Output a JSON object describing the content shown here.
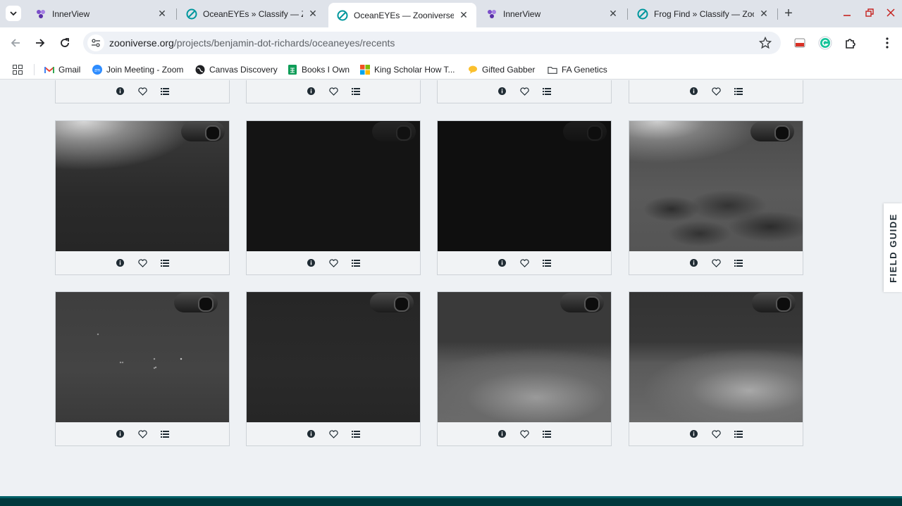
{
  "tabs": [
    {
      "title": "InnerView",
      "icon": "innerview-icon",
      "active": false
    },
    {
      "title": "OceanEYEs » Classify — Zo",
      "icon": "zooniverse-icon",
      "active": false
    },
    {
      "title": "OceanEYEs — Zooniverse",
      "icon": "zooniverse-icon",
      "active": true
    },
    {
      "title": "InnerView",
      "icon": "innerview-icon",
      "active": false
    },
    {
      "title": "Frog Find » Classify — Zoon",
      "icon": "zooniverse-icon",
      "active": false
    }
  ],
  "address": {
    "host": "zooniverse.org",
    "path": "/projects/benjamin-dot-richards/oceaneyes/recents"
  },
  "bookmarks": [
    {
      "label": "Gmail",
      "icon": "gmail-icon"
    },
    {
      "label": "Join Meeting - Zoom",
      "icon": "zoom-icon"
    },
    {
      "label": "Canvas Discovery",
      "icon": "globe-icon"
    },
    {
      "label": "Books I Own",
      "icon": "sheets-icon"
    },
    {
      "label": "King Scholar How T...",
      "icon": "microsoft-icon"
    },
    {
      "label": "Gifted Gabber",
      "icon": "chat-icon"
    },
    {
      "label": "FA Genetics",
      "icon": "folder-icon"
    }
  ],
  "field_guide": "FIELD GUIDE",
  "subject_actions": {
    "info_icon": "info-icon",
    "favorite_icon": "heart-icon",
    "collection_icon": "list-icon"
  },
  "colors": {
    "accent_teal": "#00979d",
    "footer": "#00393d",
    "page_bg": "#eef1f4"
  }
}
